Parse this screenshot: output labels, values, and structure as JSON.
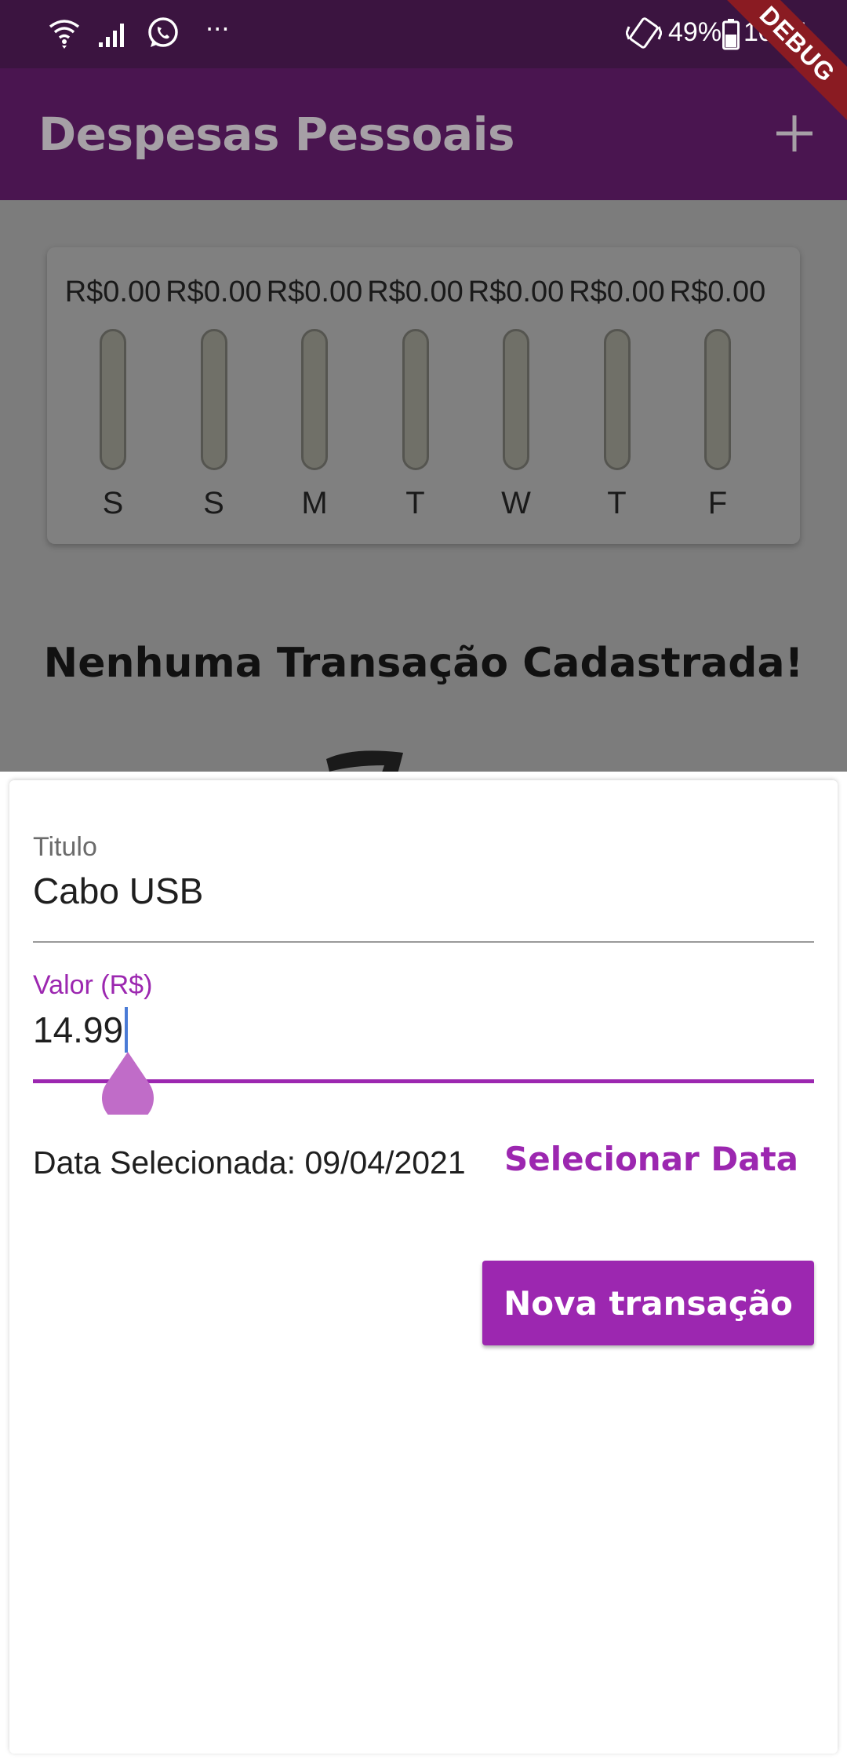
{
  "status_bar": {
    "time": "10:51",
    "battery_percent": "49%",
    "icons": [
      "wifi-icon",
      "signal-icon",
      "whatsapp-icon",
      "more-icon",
      "vibrate-icon",
      "battery-icon"
    ]
  },
  "debug_banner": "DEBUG",
  "app_bar": {
    "title": "Despesas Pessoais",
    "add_icon": "plus-icon"
  },
  "chart": {
    "bars": [
      {
        "value": "R$0.00",
        "day": "S",
        "fill": 0
      },
      {
        "value": "R$0.00",
        "day": "S",
        "fill": 0
      },
      {
        "value": "R$0.00",
        "day": "M",
        "fill": 0
      },
      {
        "value": "R$0.00",
        "day": "T",
        "fill": 0
      },
      {
        "value": "R$0.00",
        "day": "W",
        "fill": 0
      },
      {
        "value": "R$0.00",
        "day": "T",
        "fill": 0
      },
      {
        "value": "R$0.00",
        "day": "F",
        "fill": 0
      }
    ]
  },
  "empty_state": {
    "message": "Nenhuma Transação Cadastrada!"
  },
  "form": {
    "title_label": "Titulo",
    "title_value": "Cabo USB",
    "value_label": "Valor (R$)",
    "value_value": "14.99",
    "date_text": "Data Selecionada: 09/04/2021",
    "select_date_label": "Selecionar Data",
    "submit_label": "Nova transação"
  },
  "colors": {
    "primary": "#9c27b0",
    "app_bar_dimmed": "#4a1550",
    "status_bar": "#3b1440",
    "debug_banner": "#8a1b22"
  }
}
